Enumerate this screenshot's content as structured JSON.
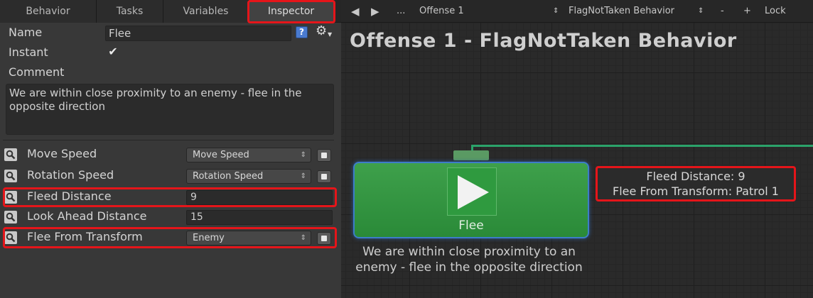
{
  "tabs": [
    {
      "label": "Behavior"
    },
    {
      "label": "Tasks"
    },
    {
      "label": "Variables"
    },
    {
      "label": "Inspector",
      "active": true
    }
  ],
  "inspector": {
    "name_label": "Name",
    "name_value": "Flee",
    "instant_label": "Instant",
    "instant_checked": "✔",
    "comment_label": "Comment",
    "comment_value": "We are within close proximity to an enemy - flee in the opposite direction",
    "properties": [
      {
        "label": "Move Speed",
        "value": "Move Speed",
        "kind": "dropdown"
      },
      {
        "label": "Rotation Speed",
        "value": "Rotation Speed",
        "kind": "dropdown"
      },
      {
        "label": "Fleed Distance",
        "value": "9",
        "kind": "text",
        "highlighted": true
      },
      {
        "label": "Look Ahead Distance",
        "value": "15",
        "kind": "text"
      },
      {
        "label": "Flee From Transform",
        "value": "Enemy",
        "kind": "dropdown",
        "highlighted": true
      }
    ]
  },
  "graph": {
    "toolbar": {
      "back": "◀",
      "forward": "▶",
      "more": "...",
      "object_name": "Offense 1",
      "behavior_name": "FlagNotTaken Behavior",
      "minus": "-",
      "plus": "+",
      "lock": "Lock"
    },
    "title": "Offense 1 - FlagNotTaken Behavior",
    "node": {
      "label": "Flee",
      "comment": "We are within close proximity to an enemy - flee in the opposite direction"
    },
    "info": {
      "line1": "Fleed Distance: 9",
      "line2": "Flee From Transform: Patrol 1"
    }
  },
  "colors": {
    "highlight": "#e5151a",
    "node_green": "#2f9a3f",
    "node_border": "#3d7dc9",
    "wire": "#2ba36a"
  }
}
